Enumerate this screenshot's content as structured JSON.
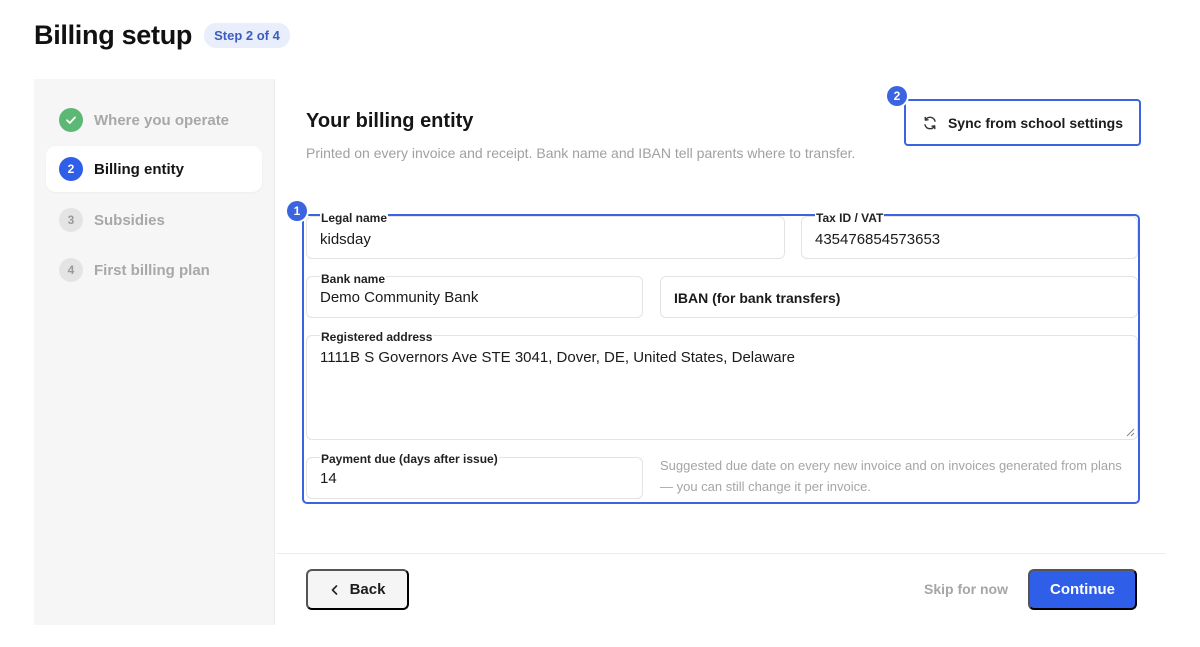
{
  "header": {
    "title": "Billing setup",
    "step_badge": "Step 2 of 4"
  },
  "sidebar": {
    "items": [
      {
        "number": "",
        "label": "Where you operate",
        "state": "done"
      },
      {
        "number": "2",
        "label": "Billing entity",
        "state": "active"
      },
      {
        "number": "3",
        "label": "Subsidies",
        "state": "todo"
      },
      {
        "number": "4",
        "label": "First billing plan",
        "state": "todo"
      }
    ]
  },
  "main": {
    "title": "Your billing entity",
    "description": "Printed on every invoice and receipt. Bank name and IBAN tell parents where to transfer.",
    "sync_button": "Sync from school settings",
    "markers": {
      "form": "1",
      "sync": "2"
    },
    "form": {
      "legal_name": {
        "label": "Legal name",
        "value": "kidsday"
      },
      "tax_id": {
        "label": "Tax ID / VAT",
        "value": "435476854573653"
      },
      "bank_name": {
        "label": "Bank name",
        "value": "Demo Community Bank"
      },
      "iban": {
        "placeholder": "IBAN (for bank transfers)"
      },
      "address": {
        "label": "Registered address",
        "value": "1111B S Governors Ave STE 3041, Dover, DE, United States, Delaware"
      },
      "payment_due": {
        "label": "Payment due (days after issue)",
        "value": "14"
      },
      "payment_help": "Suggested due date on every new invoice and on invoices generated from plans — you can still change it per invoice."
    }
  },
  "footer": {
    "back": "Back",
    "skip": "Skip for now",
    "continue": "Continue"
  },
  "colors": {
    "accent": "#2f5ee8",
    "highlight": "#3a64e0",
    "done": "#5cb874"
  }
}
